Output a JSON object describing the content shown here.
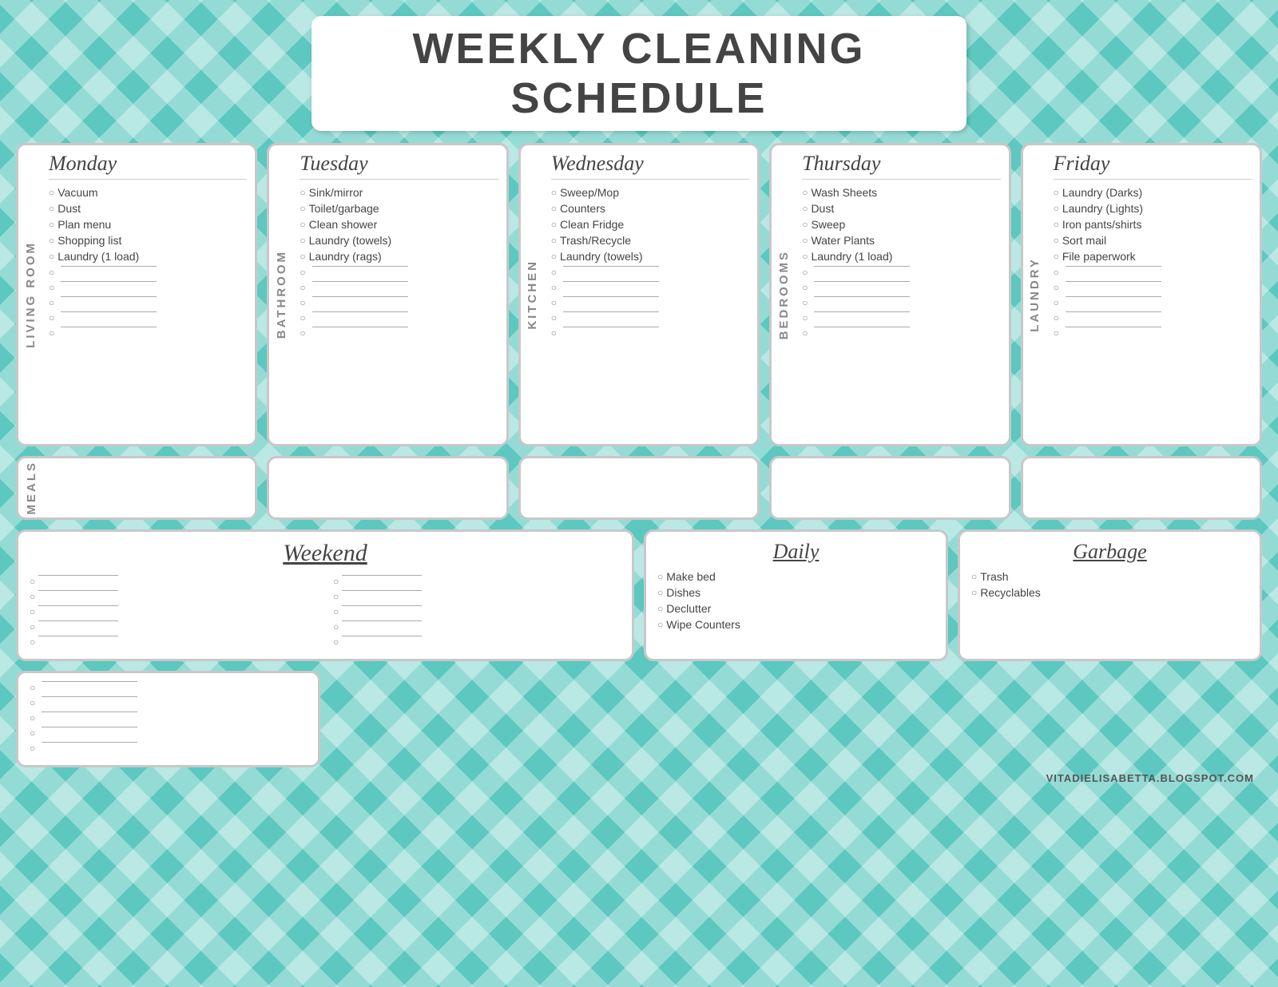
{
  "title": "WEEKLY CLEANING SCHEDULE",
  "days": [
    {
      "label": "LIVING ROOM",
      "name": "Monday",
      "tasks": [
        "Vacuum",
        "Dust",
        "Plan menu",
        "Shopping list",
        "Laundry (1 load)"
      ],
      "blanks": 5
    },
    {
      "label": "BATHROOM",
      "name": "Tuesday",
      "tasks": [
        "Sink/mirror",
        "Toilet/garbage",
        "Clean shower",
        "Laundry (towels)",
        "Laundry (rags)"
      ],
      "blanks": 5
    },
    {
      "label": "KITCHEN",
      "name": "Wednesday",
      "tasks": [
        "Sweep/Mop",
        "Counters",
        "Clean Fridge",
        "Trash/Recycle",
        "Laundry (towels)"
      ],
      "blanks": 5
    },
    {
      "label": "BEDROOMS",
      "name": "Thursday",
      "tasks": [
        "Wash Sheets",
        "Dust",
        "Sweep",
        "Water Plants",
        "Laundry (1 load)"
      ],
      "blanks": 5
    },
    {
      "label": "LAUNDRY",
      "name": "Friday",
      "tasks": [
        "Laundry (Darks)",
        "Laundry (Lights)",
        "Iron pants/shirts",
        "Sort mail",
        "File paperwork"
      ],
      "blanks": 5
    }
  ],
  "meals_label": "MEALS",
  "weekend": {
    "title": "Weekend",
    "blanks": 10
  },
  "daily": {
    "title": "Daily",
    "tasks": [
      "Make bed",
      "Dishes",
      "Declutter",
      "Wipe Counters"
    ]
  },
  "garbage": {
    "title": "Garbage",
    "tasks": [
      "Trash",
      "Recyclables"
    ]
  },
  "extra_blanks": 5,
  "watermark": "VITADIELISABETTA.BLOGSPOT.COM"
}
